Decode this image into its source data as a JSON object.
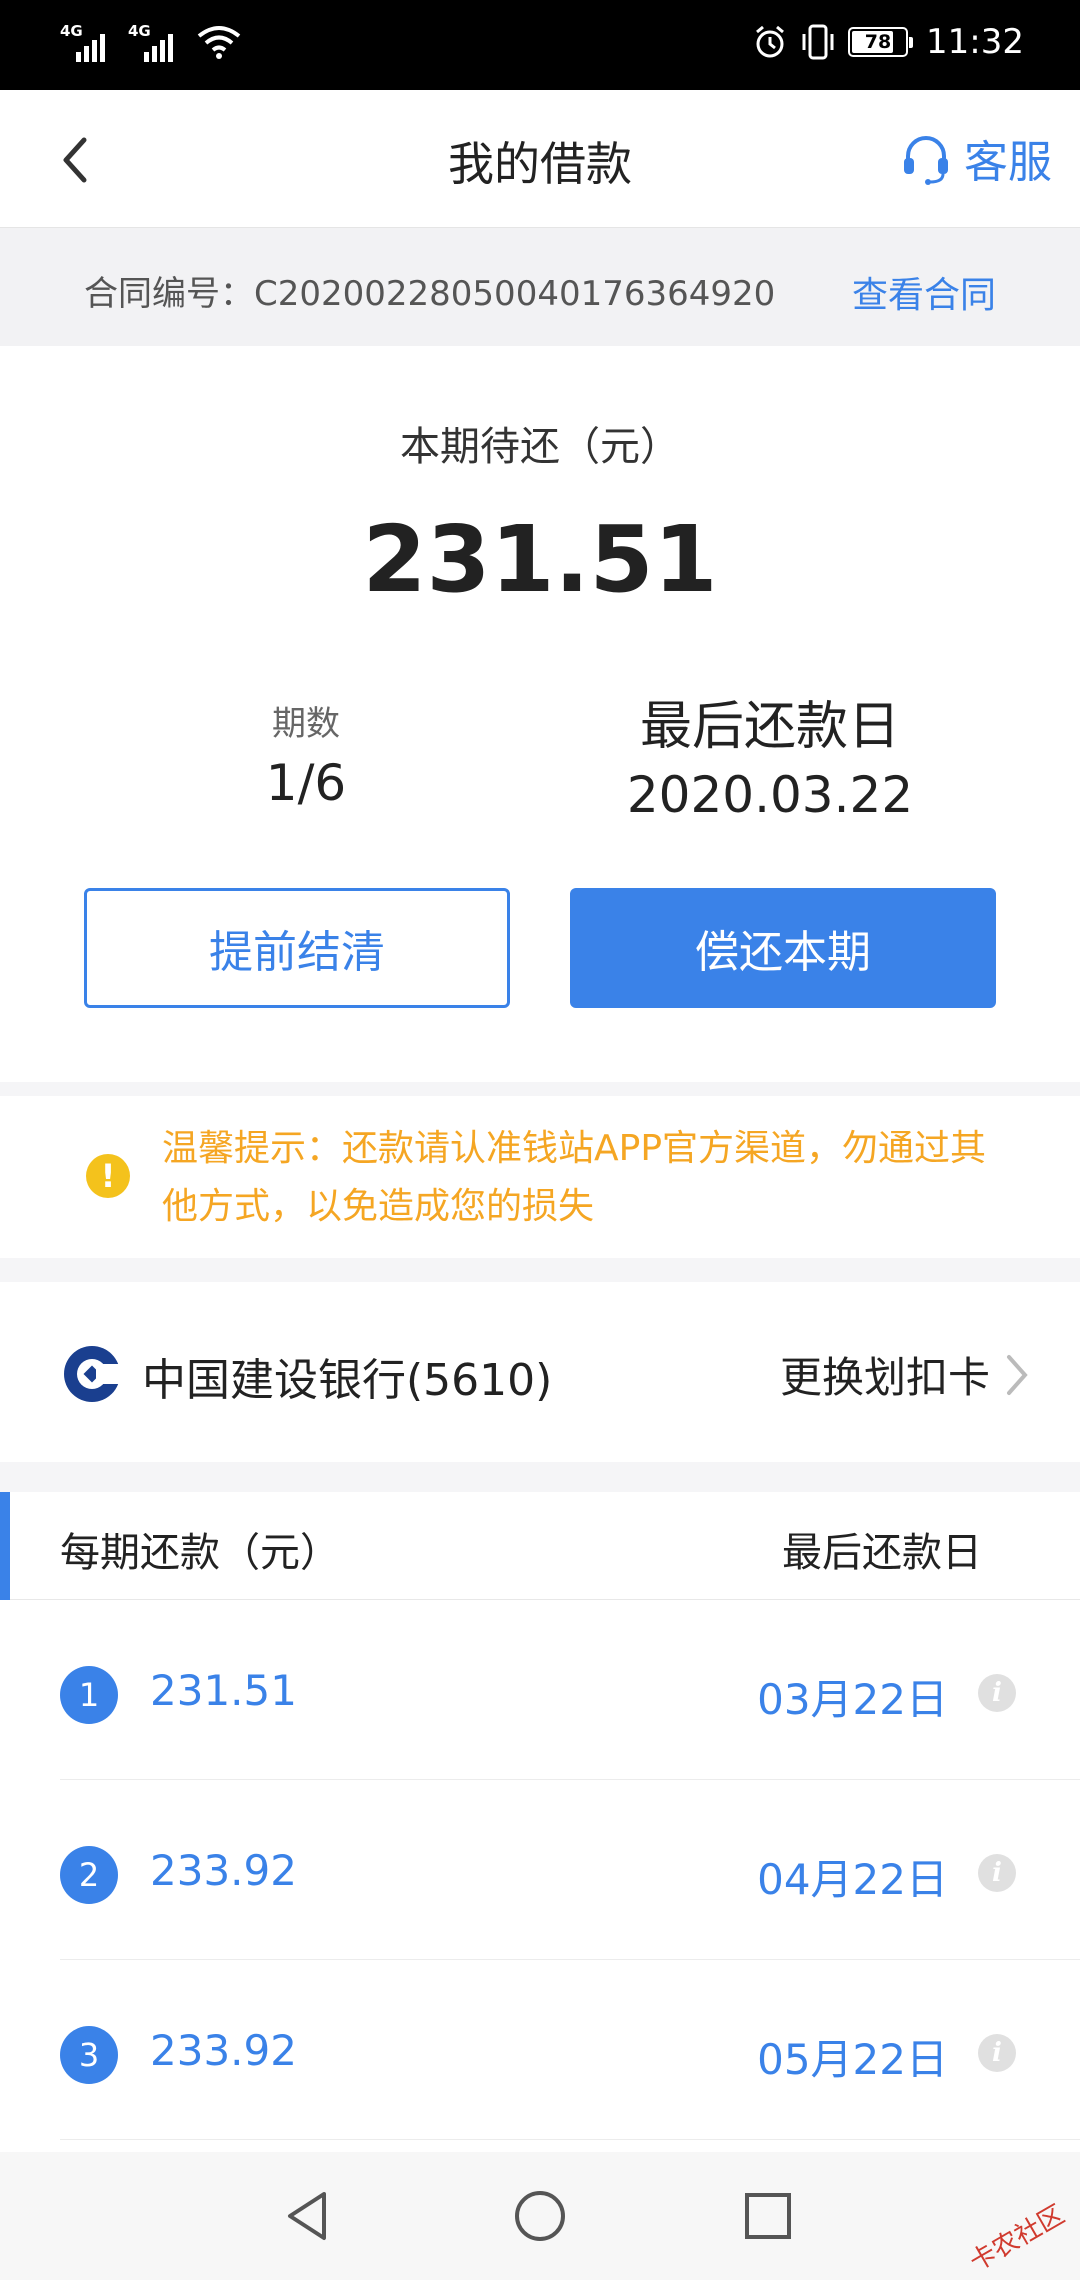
{
  "status_bar": {
    "sim1": "4G",
    "sim2": "4G",
    "battery_percent": "78",
    "battery_level": 0.78,
    "time": "11:32"
  },
  "header": {
    "title": "我的借款",
    "service_label": "客服",
    "back_icon": "chevron-left-icon",
    "service_icon": "headset-icon"
  },
  "contract": {
    "label": "合同编号：C20200228050040176364920",
    "view_link": "查看合同"
  },
  "summary": {
    "due_label": "本期待还（元）",
    "due_amount": "231.51",
    "period_label": "期数",
    "period_value": "1/6",
    "last_date_label": "最后还款日",
    "last_date_value": "2020.03.22",
    "prepay_button": "提前结清",
    "pay_button": "偿还本期"
  },
  "tip": {
    "icon": "warning-icon",
    "text": "温馨提示：还款请认准钱站APP官方渠道，勿通过其他方式，以免造成您的损失"
  },
  "bank": {
    "logo": "ccb-bank-icon",
    "name": "中国建设银行(5610)",
    "change_label": "更换划扣卡"
  },
  "schedule": {
    "col_amount": "每期还款（元）",
    "col_date": "最后还款日",
    "rows": [
      {
        "no": "1",
        "amount": "231.51",
        "date": "03月22日"
      },
      {
        "no": "2",
        "amount": "233.92",
        "date": "04月22日"
      },
      {
        "no": "3",
        "amount": "233.92",
        "date": "05月22日"
      }
    ]
  },
  "watermark": "卡农社区",
  "colors": {
    "accent": "#3a82e8",
    "tip": "#f5a623",
    "warning_icon": "#f4c21c"
  }
}
